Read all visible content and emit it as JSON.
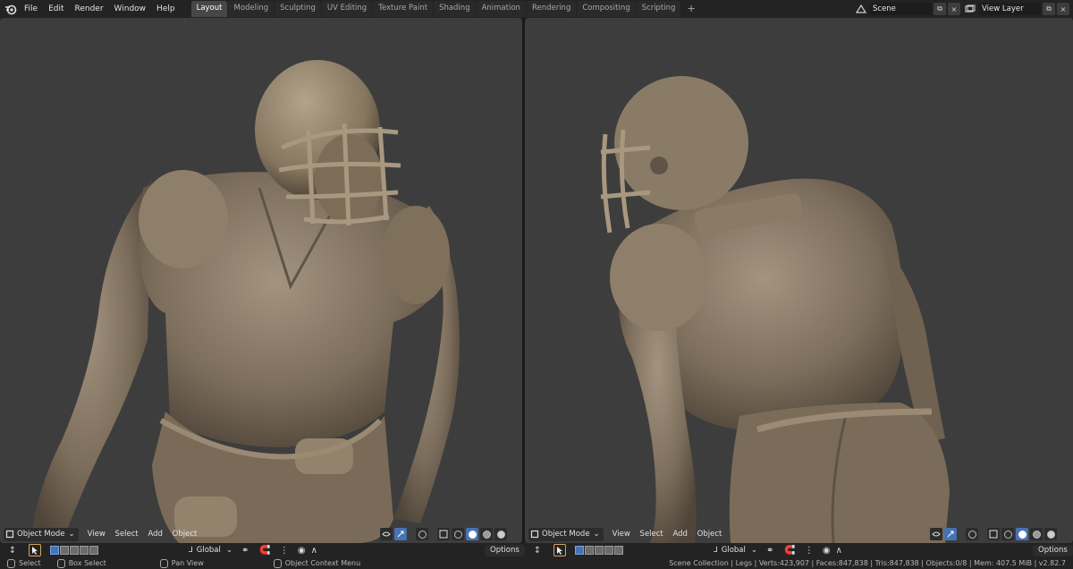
{
  "menu": [
    "File",
    "Edit",
    "Render",
    "Window",
    "Help"
  ],
  "tabs": [
    "Layout",
    "Modeling",
    "Sculpting",
    "UV Editing",
    "Texture Paint",
    "Shading",
    "Animation",
    "Rendering",
    "Compositing",
    "Scripting"
  ],
  "active_tab": "Layout",
  "add_tab": "+",
  "scene": {
    "value": "Scene"
  },
  "view_layer": {
    "value": "View Layer"
  },
  "viewport_left": {
    "mode": "Object Mode",
    "menus": [
      "View",
      "Select",
      "Add",
      "Object"
    ],
    "orientation": "Global",
    "options": "Options"
  },
  "viewport_right": {
    "mode": "Object Mode",
    "menus": [
      "View",
      "Select",
      "Add",
      "Object"
    ],
    "orientation": "Global",
    "options": "Options"
  },
  "status": {
    "select": "Select",
    "box_select": "Box Select",
    "pan_view": "Pan View",
    "context_menu": "Object Context Menu",
    "stats": "Scene Collection | Legs | Verts:423,907 | Faces:847,838 | Tris:847,838 | Objects:0/8 | Mem: 407.5 MiB | v2.82.7"
  },
  "colors": {
    "accent": "#4772b3",
    "viewport_bg": "#3d3d3d",
    "clay": "#8a7a66",
    "header_bg": "#232323"
  }
}
